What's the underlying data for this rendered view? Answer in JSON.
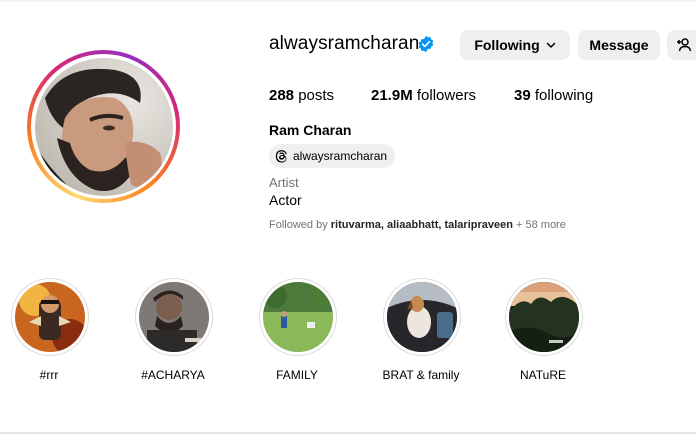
{
  "profile": {
    "username": "alwaysramcharan",
    "full_name": "Ram Charan",
    "threads_handle": "alwaysramcharan",
    "category": "Artist",
    "bio": "Actor",
    "followed_by_prefix": "Followed by ",
    "followed_by_names": "rituvarma, aliaabhatt, talaripraveen",
    "followed_by_more": " + 58 more"
  },
  "buttons": {
    "following": "Following",
    "message": "Message"
  },
  "stats": {
    "posts_value": "288",
    "posts_label": "posts",
    "followers_value": "21.9M",
    "followers_label": "followers",
    "following_value": "39",
    "following_label": "following"
  },
  "highlights": [
    {
      "label": "#rrr"
    },
    {
      "label": "#ACHARYA"
    },
    {
      "label": "FAMILY"
    },
    {
      "label": "BRAT & family"
    },
    {
      "label": "NATuRE"
    }
  ],
  "icons": {
    "verified": "verified-badge-icon",
    "chevron": "chevron-down-icon",
    "add_user": "add-user-icon",
    "threads": "threads-logo-icon"
  },
  "colors": {
    "verified_blue": "#0095f6",
    "button_bg": "#efefef",
    "muted_text": "#737373"
  }
}
